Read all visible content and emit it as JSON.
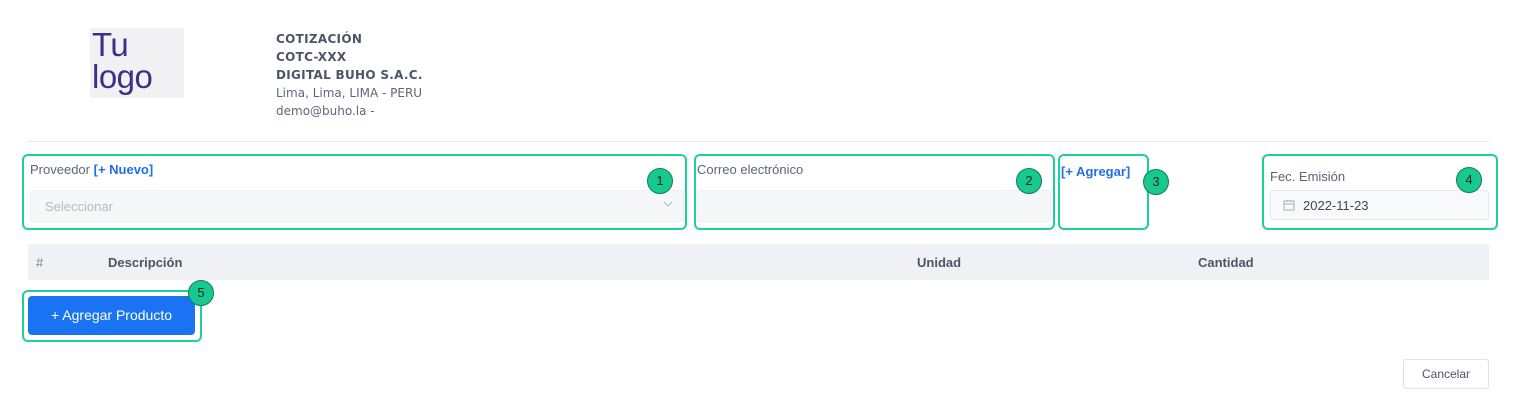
{
  "logo": {
    "line1": "Tu",
    "line2": "logo"
  },
  "company": {
    "doc_type": "COTIZACIÓN",
    "doc_number": "COTC-XXX",
    "name": "DIGITAL BUHO S.A.C.",
    "address": "Lima, Lima, LIMA - PERU",
    "email": "demo@buho.la -"
  },
  "form": {
    "supplier_label": "Proveedor",
    "supplier_new_link": "[+ Nuevo]",
    "supplier_placeholder": "Seleccionar",
    "email_label": "Correo electrónico",
    "email_value": "",
    "add_email_link": "[+ Agregar]",
    "issue_date_label": "Fec. Emisión",
    "issue_date_value": "2022-11-23"
  },
  "table": {
    "headers": [
      "#",
      "Descripción",
      "Unidad",
      "Cantidad"
    ]
  },
  "actions": {
    "add_product": "+ Agregar Producto",
    "cancel": "Cancelar"
  },
  "annotations": [
    "1",
    "2",
    "3",
    "4",
    "5"
  ],
  "colors": {
    "accent": "#1a73f2",
    "highlight": "#1fcf9a",
    "logo_text": "#3d2f88"
  }
}
